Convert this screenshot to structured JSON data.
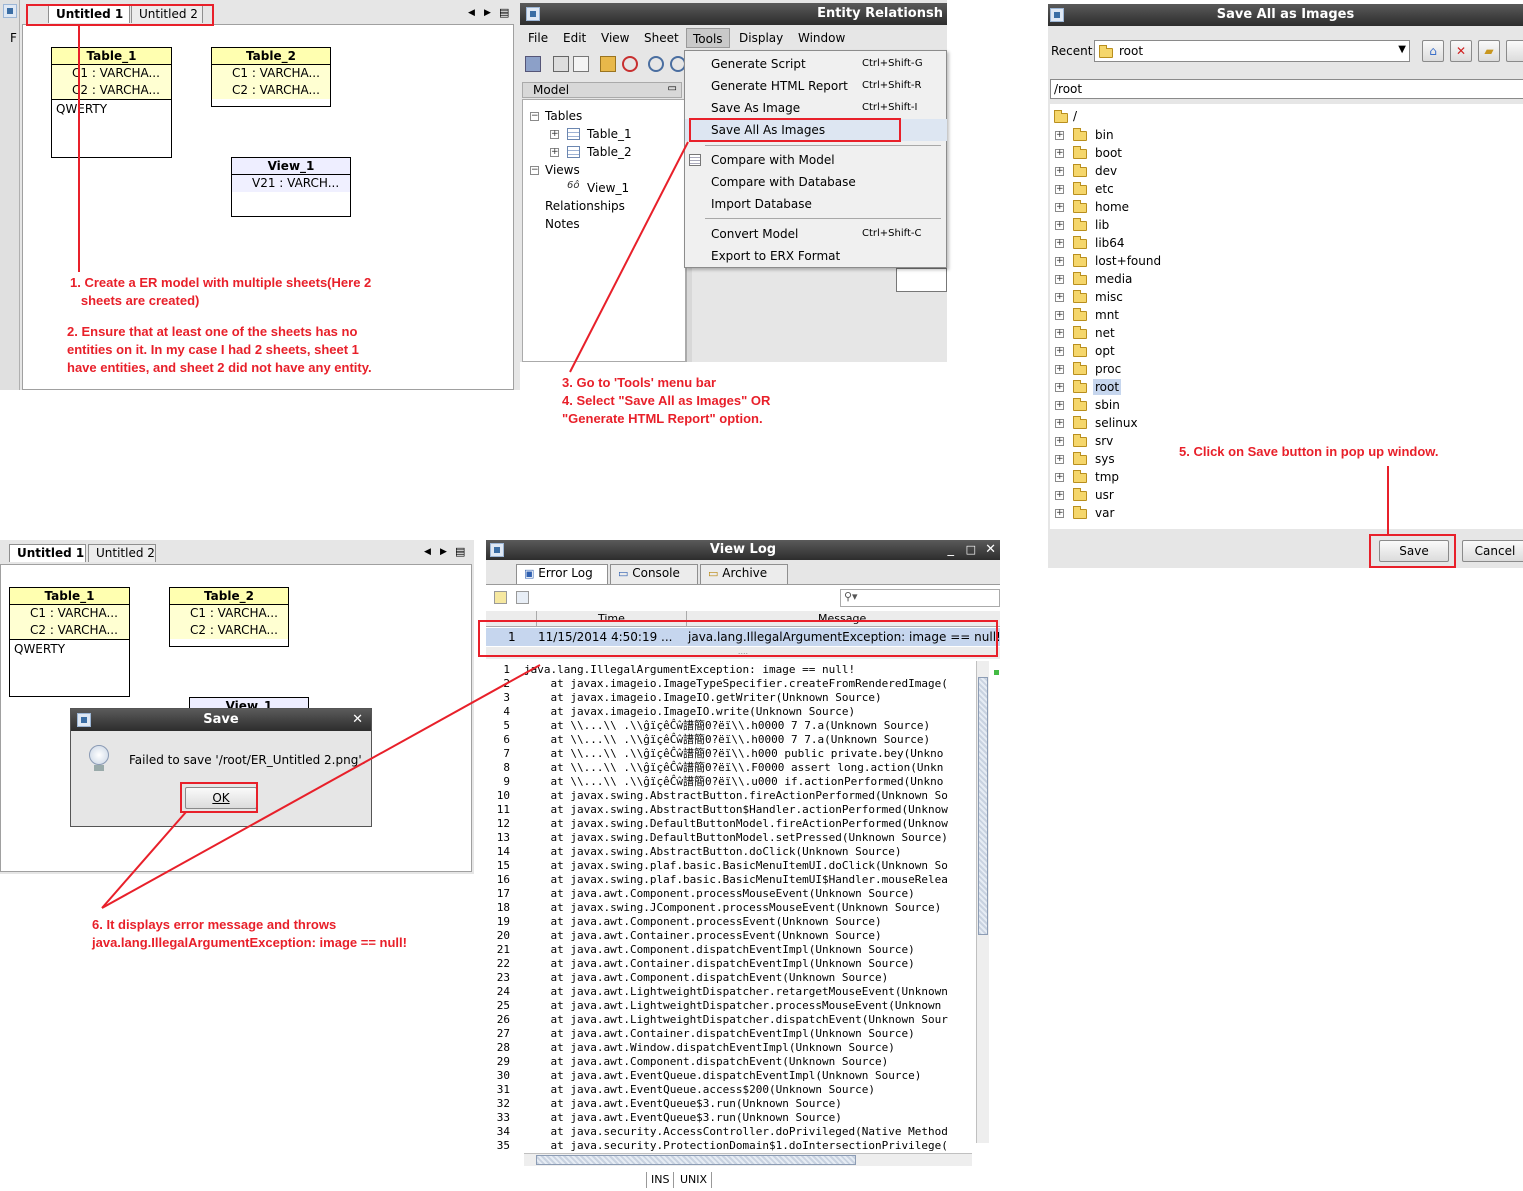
{
  "diagram1": {
    "tabs": [
      "Untitled 1",
      "Untitled 2"
    ],
    "menu_letter": "F",
    "tables": [
      {
        "name": "Table_1",
        "cols": [
          "C1 : VARCHA...",
          "C2 : VARCHA..."
        ],
        "note": "QWERTY"
      },
      {
        "name": "Table_2",
        "cols": [
          "C1 : VARCHA...",
          "C2 : VARCHA..."
        ],
        "note": ""
      }
    ],
    "view": {
      "name": "View_1",
      "cols": [
        "V21 : VARCH..."
      ]
    }
  },
  "app": {
    "title": "Entity Relationsh",
    "menus": [
      "File",
      "Edit",
      "View",
      "Sheet",
      "Tools",
      "Display",
      "Window"
    ],
    "model_panel_title": "Model",
    "tree": {
      "tables": "Tables",
      "table1": "Table_1",
      "table2": "Table_2",
      "views": "Views",
      "view1": "View_1",
      "relationships": "Relationships",
      "notes": "Notes"
    },
    "tools_menu": [
      {
        "label": "Generate Script",
        "shortcut": "Ctrl+Shift-G"
      },
      {
        "label": "Generate HTML Report",
        "shortcut": "Ctrl+Shift-R"
      },
      {
        "label": "Save As Image",
        "shortcut": "Ctrl+Shift-I"
      },
      {
        "label": "Save All As Images",
        "shortcut": ""
      },
      {
        "label": "Compare with Model",
        "shortcut": ""
      },
      {
        "label": "Compare with Database",
        "shortcut": ""
      },
      {
        "label": "Import Database",
        "shortcut": ""
      },
      {
        "label": "Convert Model",
        "shortcut": "Ctrl+Shift-C"
      },
      {
        "label": "Export to ERX Format",
        "shortcut": ""
      }
    ]
  },
  "save_dialog": {
    "title": "Save All as Images",
    "recent_label": "Recent:",
    "recent_value": "root",
    "path": "/root",
    "root_folder": "/",
    "folders": [
      "bin",
      "boot",
      "dev",
      "etc",
      "home",
      "lib",
      "lib64",
      "lost+found",
      "media",
      "misc",
      "mnt",
      "net",
      "opt",
      "proc",
      "root",
      "sbin",
      "selinux",
      "srv",
      "sys",
      "tmp",
      "usr",
      "var"
    ],
    "selected_folder": "root",
    "save_label": "Save",
    "cancel_label": "Cancel"
  },
  "diagram2": {
    "tabs": [
      "Untitled 1",
      "Untitled 2"
    ],
    "tables": [
      {
        "name": "Table_1",
        "cols": [
          "C1 : VARCHA...",
          "C2 : VARCHA..."
        ],
        "note": "QWERTY"
      },
      {
        "name": "Table_2",
        "cols": [
          "C1 : VARCHA...",
          "C2 : VARCHA..."
        ],
        "note": ""
      }
    ],
    "view_name": "View_1"
  },
  "error_dialog": {
    "title": "Save",
    "message": "Failed to save '/root/ER_Untitled 2.png'.",
    "ok_label": "OK"
  },
  "viewlog": {
    "title": "View Log",
    "tabs": [
      "Error Log",
      "Console",
      "Archive"
    ],
    "col_time": "Time",
    "col_message": "Message",
    "row": {
      "num": "1",
      "time": "11/15/2014 4:50:19 ...",
      "message": "java.lang.IllegalArgumentException: image == null!"
    },
    "status": [
      "INS",
      "UNIX"
    ],
    "lines": [
      "java.lang.IllegalArgumentException: image == null!",
      "    at javax.imageio.ImageTypeSpecifier.createFromRenderedImage(",
      "    at javax.imageio.ImageIO.getWriter(Unknown Source)",
      "    at javax.imageio.ImageIO.write(Unknown Source)",
      "    at \\\\...\\\\ .\\\\ĝïçêĈŵ譜簡0?ëï\\\\.h0000 7 7.a(Unknown Source)",
      "    at \\\\...\\\\ .\\\\ĝïçêĈŵ譜簡0?ëï\\\\.h0000 7 7.a(Unknown Source)",
      "    at \\\\...\\\\ .\\\\ĝïçêĈŵ譜簡0?ëï\\\\.h000 public private.bey(Unkno",
      "    at \\\\...\\\\ .\\\\ĝïçêĈŵ譜簡0?ëï\\\\.F0000 assert long.action(Unkn",
      "    at \\\\...\\\\ .\\\\ĝïçêĈŵ譜簡0?ëï\\\\.u000 if.actionPerformed(Unkno",
      "    at javax.swing.AbstractButton.fireActionPerformed(Unknown So",
      "    at javax.swing.AbstractButton$Handler.actionPerformed(Unknow",
      "    at javax.swing.DefaultButtonModel.fireActionPerformed(Unknow",
      "    at javax.swing.DefaultButtonModel.setPressed(Unknown Source)",
      "    at javax.swing.AbstractButton.doClick(Unknown Source)",
      "    at javax.swing.plaf.basic.BasicMenuItemUI.doClick(Unknown So",
      "    at javax.swing.plaf.basic.BasicMenuItemUI$Handler.mouseRelea",
      "    at java.awt.Component.processMouseEvent(Unknown Source)",
      "    at javax.swing.JComponent.processMouseEvent(Unknown Source)",
      "    at java.awt.Component.processEvent(Unknown Source)",
      "    at java.awt.Container.processEvent(Unknown Source)",
      "    at java.awt.Component.dispatchEventImpl(Unknown Source)",
      "    at java.awt.Container.dispatchEventImpl(Unknown Source)",
      "    at java.awt.Component.dispatchEvent(Unknown Source)",
      "    at java.awt.LightweightDispatcher.retargetMouseEvent(Unknown",
      "    at java.awt.LightweightDispatcher.processMouseEvent(Unknown",
      "    at java.awt.LightweightDispatcher.dispatchEvent(Unknown Sour",
      "    at java.awt.Container.dispatchEventImpl(Unknown Source)",
      "    at java.awt.Window.dispatchEventImpl(Unknown Source)",
      "    at java.awt.Component.dispatchEvent(Unknown Source)",
      "    at java.awt.EventQueue.dispatchEventImpl(Unknown Source)",
      "    at java.awt.EventQueue.access$200(Unknown Source)",
      "    at java.awt.EventQueue$3.run(Unknown Source)",
      "    at java.awt.EventQueue$3.run(Unknown Source)",
      "    at java.security.AccessController.doPrivileged(Native Method",
      "    at java.security.ProtectionDomain$1.doIntersectionPrivilege("
    ]
  },
  "annotations": {
    "step1": "1. Create a ER model with multiple sheets(Here 2\n   sheets are created)",
    "step2": "2. Ensure that at least one of the sheets has no\nentities on it. In my case I had 2 sheets, sheet 1\nhave entities, and sheet 2 did not have any entity.",
    "step34": "3. Go to 'Tools' menu bar\n4. Select \"Save All as Images\" OR\n\"Generate HTML Report\" option.",
    "step5": "5. Click on Save button in pop up window.",
    "step6": "6. It displays error message and throws\njava.lang.IllegalArgumentException: image == null!"
  },
  "colors": {
    "annotation_red": "#e8202a",
    "selection_blue": "#c6d6ee",
    "note_yellow": "#ffffb0"
  }
}
